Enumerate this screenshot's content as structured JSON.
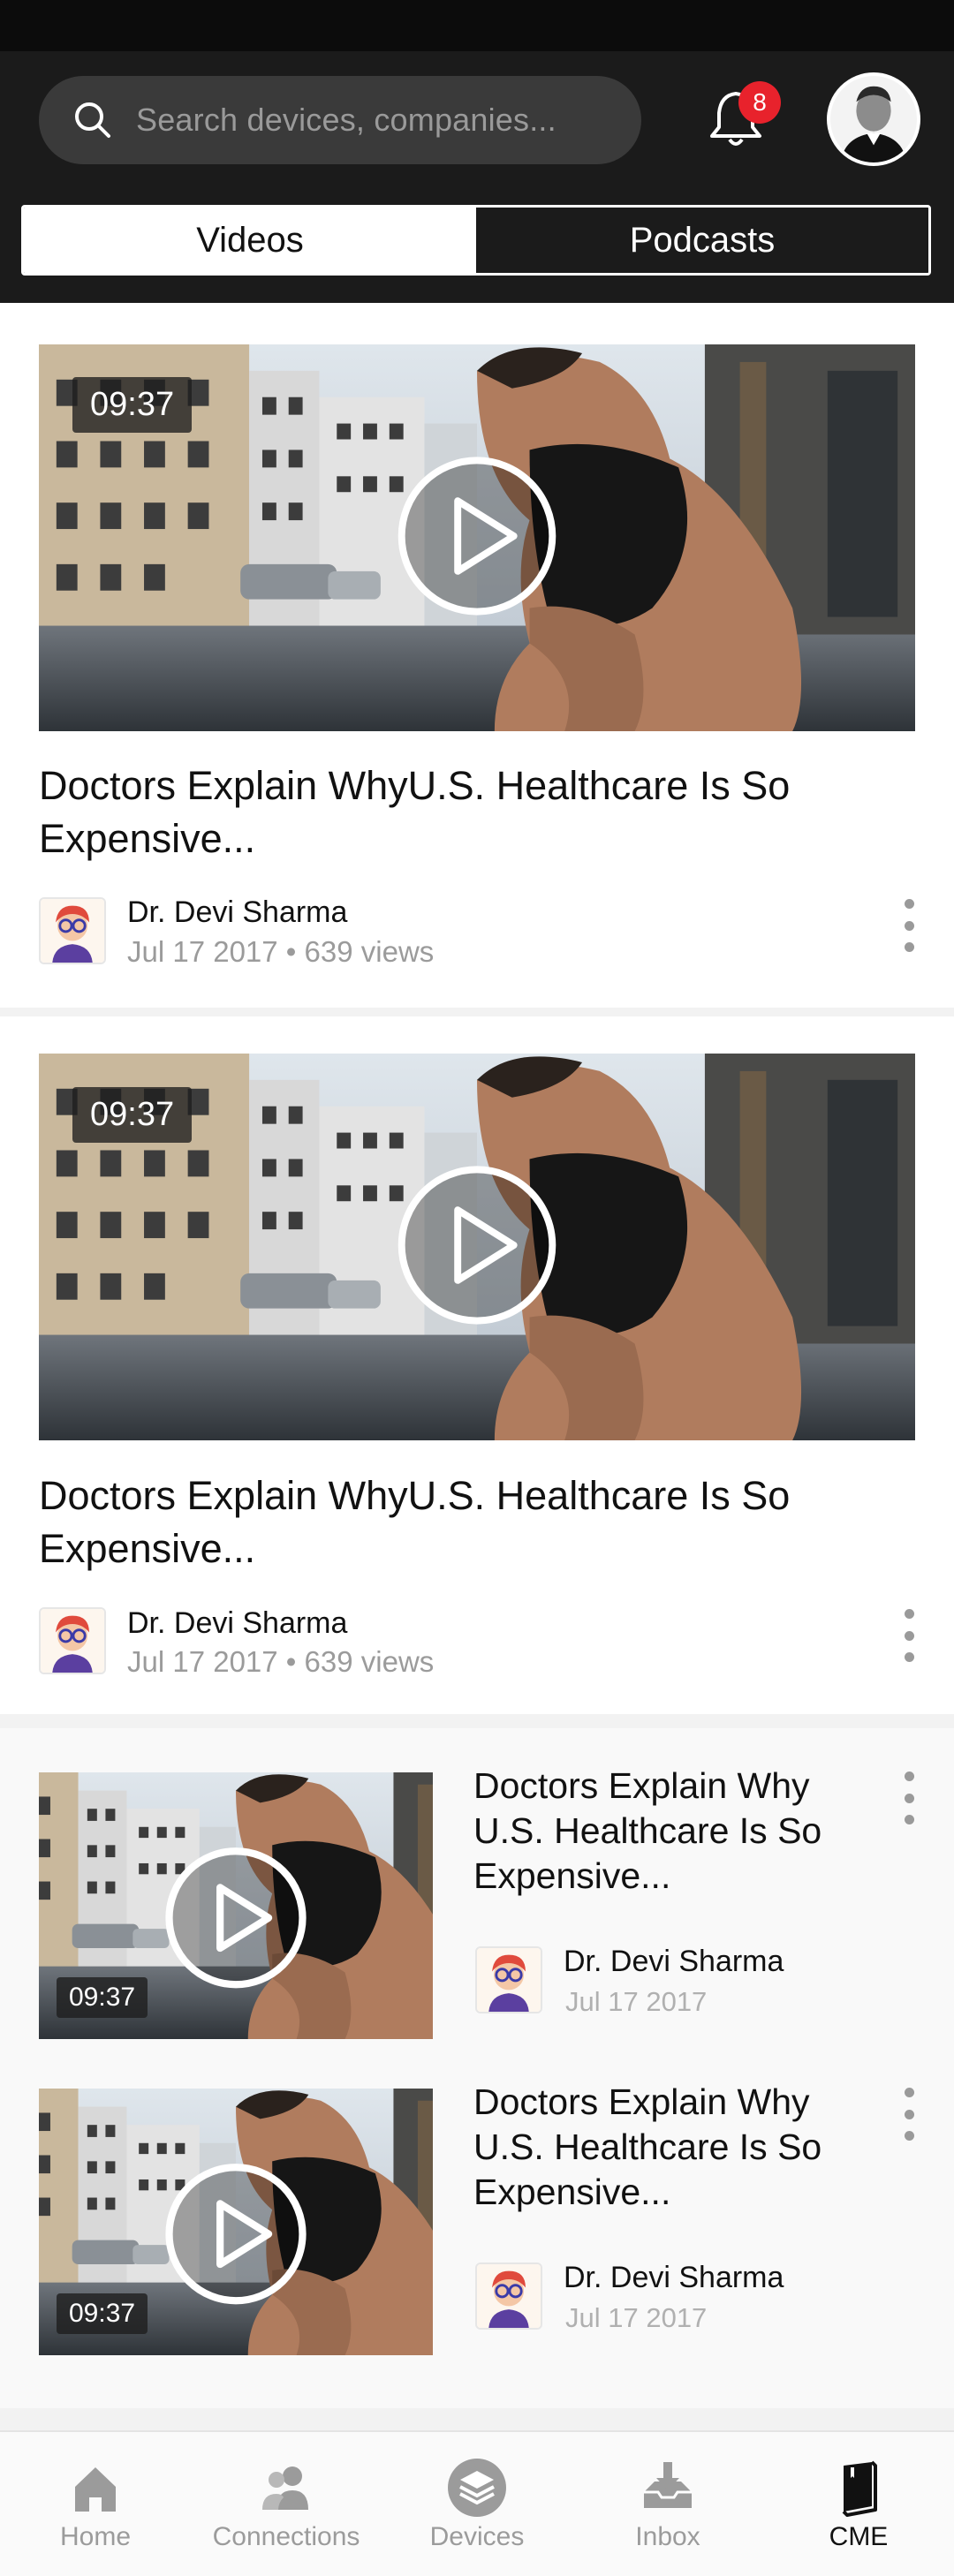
{
  "search": {
    "placeholder": "Search devices, companies..."
  },
  "notifications": {
    "count": "8"
  },
  "tabs": [
    {
      "label": "Videos",
      "active": true
    },
    {
      "label": "Podcasts",
      "active": false
    }
  ],
  "featured_videos": [
    {
      "duration": "09:37",
      "title": "Doctors Explain WhyU.S. Healthcare Is So Expensive...",
      "author": "Dr. Devi Sharma",
      "meta": "Jul 17 2017 • 639 views"
    },
    {
      "duration": "09:37",
      "title": "Doctors Explain WhyU.S. Healthcare Is So Expensive...",
      "author": "Dr. Devi Sharma",
      "meta": "Jul 17 2017 • 639 views"
    }
  ],
  "list_videos": [
    {
      "duration": "09:37",
      "title": "Doctors Explain Why U.S. Healthcare Is So Expensive...",
      "author": "Dr. Devi Sharma",
      "date": "Jul 17 2017"
    },
    {
      "duration": "09:37",
      "title": "Doctors Explain Why U.S. Healthcare Is So Expensive...",
      "author": "Dr. Devi Sharma",
      "date": "Jul 17 2017"
    }
  ],
  "bottom_nav": [
    {
      "label": "Home",
      "icon": "home-icon",
      "active": false
    },
    {
      "label": "Connections",
      "icon": "connections-icon",
      "active": false
    },
    {
      "label": "Devices",
      "icon": "devices-icon",
      "active": false
    },
    {
      "label": "Inbox",
      "icon": "inbox-icon",
      "active": false
    },
    {
      "label": "CME",
      "icon": "cme-book-icon",
      "active": true
    }
  ],
  "colors": {
    "header_bg": "#1b1b1b",
    "badge": "#e8222c",
    "muted_text": "#9b9b9b"
  }
}
